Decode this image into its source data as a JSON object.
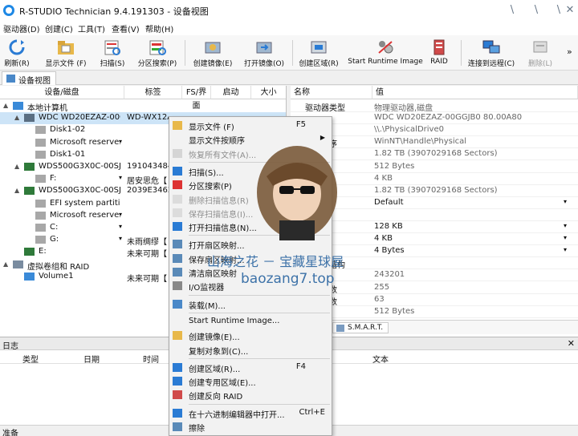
{
  "window": {
    "title": "R-STUDIO Technician 9.4.191303 - 设备视图",
    "controls": [
      "\\",
      "\\",
      "\\",
      "✕"
    ]
  },
  "menu": [
    "驱动器(D)",
    "创建(C)",
    "工具(T)",
    "查看(V)",
    "帮助(H)"
  ],
  "toolbar": {
    "buttons": [
      {
        "label": "刷新(R)",
        "icon": "refresh-icon"
      },
      {
        "label": "显示文件 (F)",
        "icon": "folder-icon"
      },
      {
        "label": "扫描(S)",
        "icon": "scan-icon"
      },
      {
        "label": "分区搜索(P)",
        "icon": "partition-search-icon"
      },
      {
        "label": "创建镜像(E)",
        "icon": "image-icon"
      },
      {
        "label": "打开镜像(O)",
        "icon": "open-image-icon"
      },
      {
        "label": "创建区域(R)",
        "icon": "region-icon"
      },
      {
        "label": "Start Runtime Image",
        "icon": "runtime-icon"
      },
      {
        "label": "RAID",
        "icon": "raid-icon"
      },
      {
        "label": "连接到远程(C)",
        "icon": "remote-icon"
      },
      {
        "label": "删除(L)",
        "icon": "delete-icon"
      }
    ],
    "overflow": "»"
  },
  "tab": "设备视图",
  "tree": {
    "columns": [
      "设备/磁盘",
      "标签",
      "FS/界面",
      "启动",
      "大小"
    ],
    "rows": [
      {
        "name": "本地计算机",
        "label": "",
        "level": 0,
        "exp": "▲",
        "icon": "computer"
      },
      {
        "name": "WDC WD20EZAZ-00G...",
        "label": "WD-WX12A",
        "level": 1,
        "exp": "▲",
        "icon": "hdd",
        "selected": true
      },
      {
        "name": "Disk1-02",
        "label": "",
        "level": 2,
        "exp": "",
        "icon": "part"
      },
      {
        "name": "Microsoft reserve...",
        "label": "",
        "level": 2,
        "exp": "",
        "icon": "part",
        "dropdown": true
      },
      {
        "name": "Disk1-01",
        "label": "",
        "level": 2,
        "exp": "",
        "icon": "part"
      },
      {
        "name": "WDS500G3X0C-00SJG...",
        "label": "1910434848",
        "level": 1,
        "exp": "▲",
        "icon": "ssd"
      },
      {
        "name": "F:",
        "label": "居安思危【",
        "level": 2,
        "exp": "",
        "icon": "part",
        "dropdown": true
      },
      {
        "name": "WDS500G3X0C-00SJG...",
        "label": "2039E34624",
        "level": 1,
        "exp": "▲",
        "icon": "ssd"
      },
      {
        "name": "EFI system partition",
        "label": "",
        "level": 2,
        "exp": "",
        "icon": "part"
      },
      {
        "name": "Microsoft reserve...",
        "label": "",
        "level": 2,
        "exp": "",
        "icon": "part",
        "dropdown": true
      },
      {
        "name": "C:",
        "label": "",
        "level": 2,
        "exp": "",
        "icon": "part",
        "dropdown": true
      },
      {
        "name": "G:",
        "label": "未雨绸缪【",
        "level": 2,
        "exp": "",
        "icon": "part",
        "dropdown": true
      },
      {
        "name": "E:",
        "label": "未来可期【",
        "level": 1,
        "exp": "",
        "icon": "ssd"
      },
      {
        "name": "虚拟卷组和 RAID",
        "label": "",
        "level": 0,
        "exp": "▲",
        "icon": "raid"
      },
      {
        "name": "Volume1",
        "label": "未来可期【",
        "level": 1,
        "exp": "",
        "icon": "vol"
      }
    ]
  },
  "properties": {
    "columns": [
      "名称",
      "值"
    ],
    "rows": [
      {
        "name": "驱动器类型",
        "value": "物理驱动器,磁盘",
        "dark": false
      },
      {
        "name": "",
        "value": "WDC WD20EZAZ-00GGJB0 80.00A80",
        "dark": false
      },
      {
        "name": "对象",
        "value": "\\\\.\\PhysicalDrive0",
        "dark": false
      },
      {
        "name": "驱动程序",
        "value": "WinNT\\Handle\\Physical",
        "dark": false
      },
      {
        "name": "",
        "value": "1.82 TB (3907029168 Sectors)",
        "dark": false
      },
      {
        "name": "大小",
        "value": "512 Bytes",
        "dark": false
      },
      {
        "name": "大小",
        "value": "4 KB",
        "dark": false
      },
      {
        "name": "",
        "value": "1.82 TB (3907029168 Sectors)",
        "dark": false
      },
      {
        "name": "",
        "value": "Default",
        "dark": true,
        "dropdown": true
      },
      {
        "name": "",
        "value": "",
        "dark": false
      },
      {
        "name": "传输",
        "value": "128 KB",
        "dark": true,
        "dropdown": true
      },
      {
        "name": "大小",
        "value": "4 KB",
        "dark": true,
        "dropdown": true
      },
      {
        "name": "对齐",
        "value": "4 Bytes",
        "dark": true,
        "dropdown": true
      },
      {
        "name": "器几何结构",
        "value": "",
        "dark": false
      },
      {
        "name": "",
        "value": "243201",
        "dark": false
      },
      {
        "name": "柱磁道数",
        "value": "255",
        "dark": false
      },
      {
        "name": "道扇区数",
        "value": "63",
        "dark": false
      },
      {
        "name": "大小",
        "value": "512 Bytes",
        "dark": false
      }
    ],
    "tabs": [
      "S.M.A.R.T."
    ]
  },
  "log": {
    "title": "日志",
    "close": "✕",
    "columns": [
      "类型",
      "日期",
      "时间",
      "文本"
    ]
  },
  "status": "准备",
  "context_menu": [
    {
      "label": "显示文件 (F)",
      "shortcut": "F5",
      "icon": "folder",
      "disabled": false
    },
    {
      "label": "显示文件按顺序",
      "shortcut": "",
      "icon": "",
      "disabled": false,
      "arrow": "▶"
    },
    {
      "label": "恢复所有文件(A)...",
      "shortcut": "",
      "icon": "restore",
      "disabled": true
    },
    {
      "sep": true
    },
    {
      "label": "扫描(S)...",
      "shortcut": "",
      "icon": "scan",
      "disabled": false
    },
    {
      "label": "分区搜索(P)",
      "shortcut": "",
      "icon": "search",
      "disabled": false
    },
    {
      "label": "删除扫描信息(R)",
      "shortcut": "",
      "icon": "del",
      "disabled": true
    },
    {
      "label": "保存扫描信息(I)...",
      "shortcut": "",
      "icon": "save",
      "disabled": true
    },
    {
      "label": "打开扫描信息(N)...",
      "shortcut": "",
      "icon": "open",
      "disabled": false
    },
    {
      "sep": true
    },
    {
      "label": "打开扇区映射...",
      "shortcut": "",
      "icon": "map",
      "disabled": false
    },
    {
      "label": "保存扇区映射...",
      "shortcut": "",
      "icon": "map",
      "disabled": false
    },
    {
      "label": "清洁扇区映射",
      "shortcut": "",
      "icon": "map",
      "disabled": false
    },
    {
      "label": "I/O监视器",
      "shortcut": "",
      "icon": "io",
      "disabled": false
    },
    {
      "sep": true
    },
    {
      "label": "装载(M)...",
      "shortcut": "",
      "icon": "mount",
      "disabled": false
    },
    {
      "sep": true
    },
    {
      "label": "Start Runtime Image...",
      "shortcut": "",
      "icon": "",
      "disabled": false
    },
    {
      "label": "创建镜像(E)...",
      "shortcut": "",
      "icon": "image",
      "disabled": false
    },
    {
      "label": "复制对象到(C)...",
      "shortcut": "",
      "icon": "",
      "disabled": false
    },
    {
      "sep": true
    },
    {
      "label": "创建区域(R)...",
      "shortcut": "F4",
      "icon": "region",
      "disabled": false
    },
    {
      "label": "创建专用区域(E)...",
      "shortcut": "",
      "icon": "region",
      "disabled": false
    },
    {
      "label": "创建反向 RAID",
      "shortcut": "",
      "icon": "raid",
      "disabled": false
    },
    {
      "sep": true
    },
    {
      "label": "在十六进制编辑器中打开...",
      "shortcut": "Ctrl+E",
      "icon": "hex",
      "disabled": false
    },
    {
      "label": "擦除",
      "shortcut": "",
      "icon": "erase",
      "disabled": false
    }
  ],
  "watermark": {
    "line1": "山海之花 － 宝藏星球屋",
    "line2": "baozang7.top"
  },
  "colors": {
    "accent": "#1e88e5",
    "selection": "#cde4f7",
    "menu_bg": "#f2f2f2"
  }
}
